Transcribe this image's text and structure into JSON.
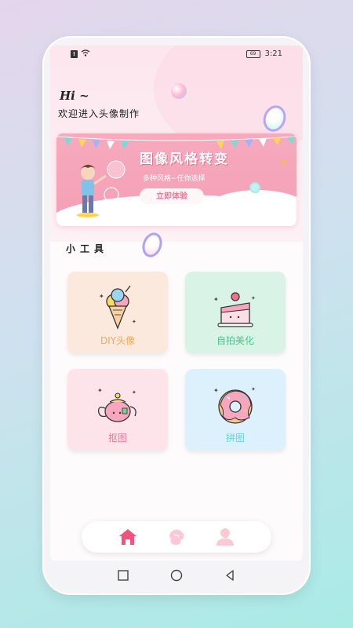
{
  "status_bar": {
    "time": "3:21",
    "battery": "69"
  },
  "header": {
    "greeting": "Hi ~",
    "welcome": "欢迎进入头像制作"
  },
  "banner": {
    "title": "图像风格转变",
    "subtitle": "多种风格~任你选择",
    "button_label": "立即体验"
  },
  "tools": {
    "title": "小工具",
    "items": [
      {
        "label": "DIY头像",
        "icon": "ice-cream-icon"
      },
      {
        "label": "自拍美化",
        "icon": "cake-icon"
      },
      {
        "label": "抠图",
        "icon": "teapot-icon"
      },
      {
        "label": "拼图",
        "icon": "donut-icon"
      }
    ]
  },
  "tabbar": {
    "items": [
      "home-icon",
      "face-icon",
      "profile-icon"
    ],
    "active": "home-icon"
  },
  "colors": {
    "accent": "#f2527e",
    "banner": "#f4a7bb"
  }
}
